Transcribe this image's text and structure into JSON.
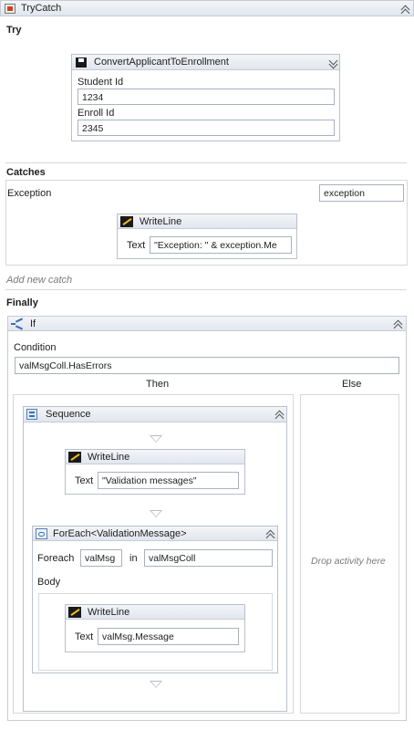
{
  "trycatch": {
    "title": "TryCatch"
  },
  "try": {
    "label": "Try",
    "activity": {
      "title": "ConvertApplicantToEnrollment",
      "student_id_label": "Student Id",
      "student_id_value": "1234",
      "enroll_id_label": "Enroll Id",
      "enroll_id_value": "2345"
    }
  },
  "catches": {
    "label": "Catches",
    "exception_type": "Exception",
    "exception_var": "exception",
    "writeline": {
      "title": "WriteLine",
      "text_label": "Text",
      "text_value": "\"Exception: \" & exception.Me"
    },
    "add_new_catch": "Add new catch"
  },
  "finally": {
    "label": "Finally",
    "if": {
      "title": "If",
      "condition_label": "Condition",
      "condition_value": "valMsgColl.HasErrors",
      "then_label": "Then",
      "else_label": "Else",
      "else_placeholder": "Drop activity here",
      "sequence": {
        "title": "Sequence",
        "writeline1": {
          "title": "WriteLine",
          "text_label": "Text",
          "text_value": "\"Validation messages\""
        },
        "foreach": {
          "title": "ForEach<ValidationMessage>",
          "foreach_label": "Foreach",
          "item_var": "valMsg",
          "in_label": "in",
          "collection": "valMsgColl",
          "body_label": "Body",
          "writeline": {
            "title": "WriteLine",
            "text_label": "Text",
            "text_value": "valMsg.Message"
          }
        }
      }
    }
  }
}
